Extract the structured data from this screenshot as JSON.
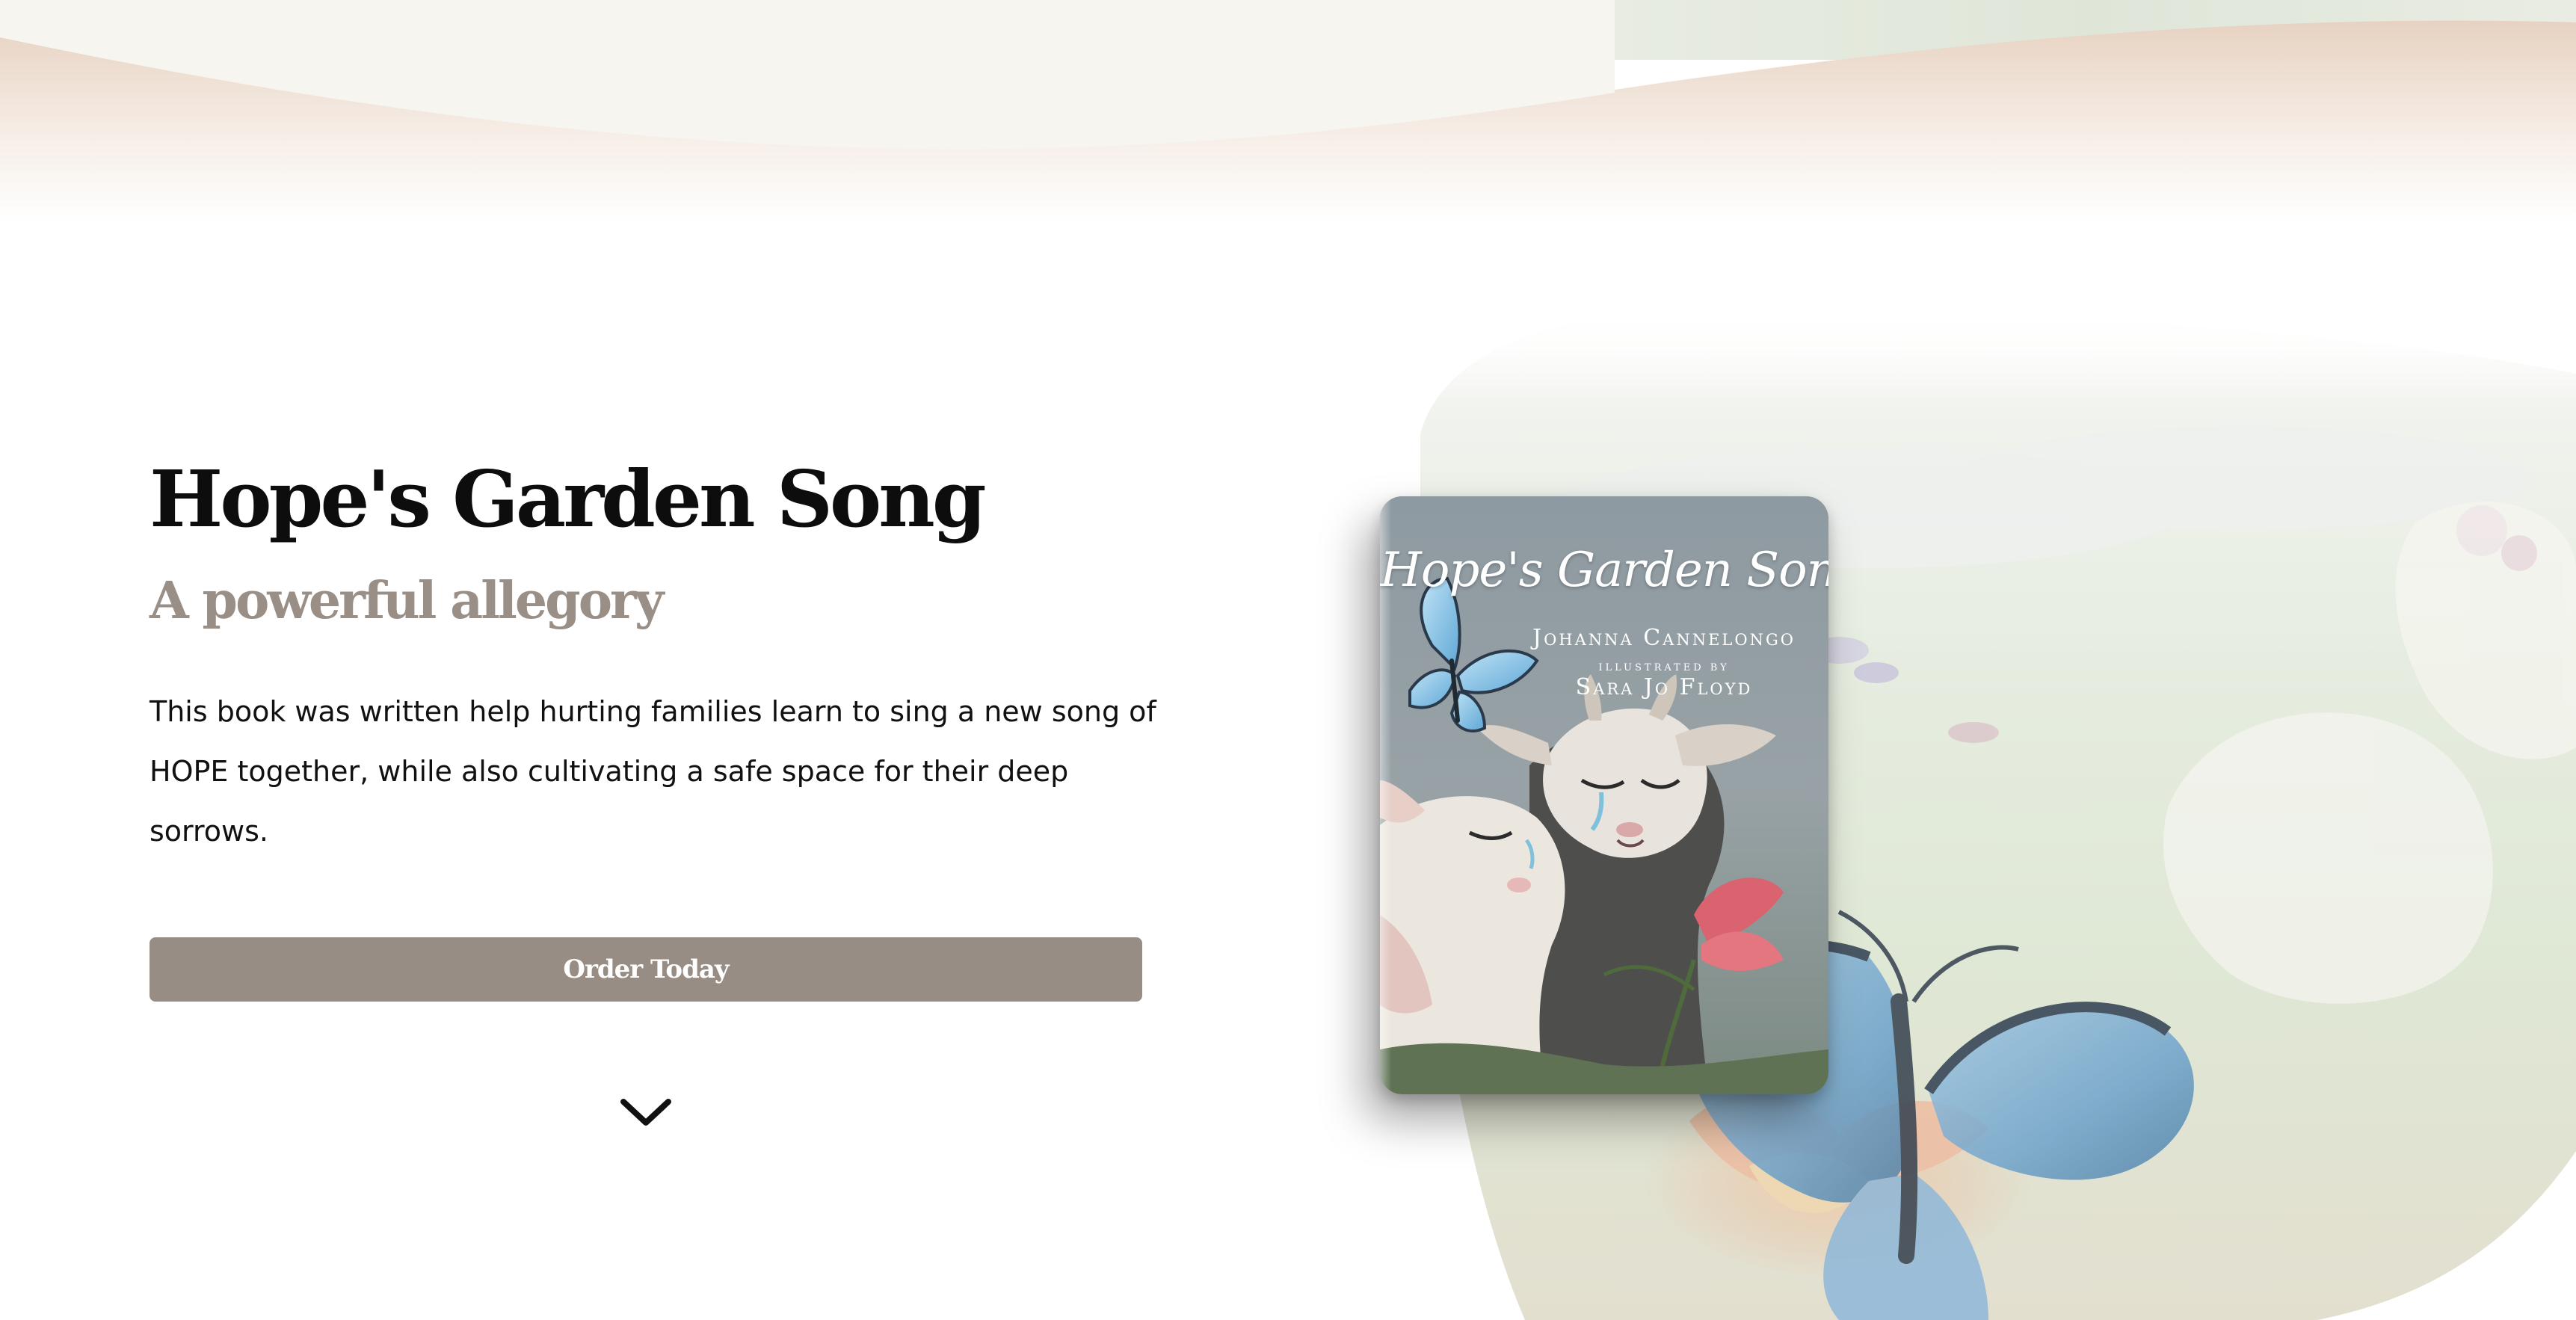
{
  "hero": {
    "title": "Hope's Garden Song",
    "subtitle": "A powerful allegory",
    "description": "This book was written help hurting families learn to sing a new song of HOPE together, while also cultivating a safe space for their deep sorrows.",
    "order_button_label": "Order Today",
    "scroll_icon": "chevron-down-icon"
  },
  "book_cover": {
    "title": "Hope's Garden Song",
    "author": "Johanna Cannelongo",
    "illustrated_by": "Illustrated by",
    "illustrator": "Sara Jo Floyd"
  },
  "colors": {
    "heading": "#0d0d0d",
    "subtitle": "#9a8f86",
    "button": "#978d84",
    "button_text": "#ffffff",
    "band_cream": "#f7f5f0",
    "band_peach": "#ead8c8",
    "butterfly_blue": "#7fb3d6"
  }
}
